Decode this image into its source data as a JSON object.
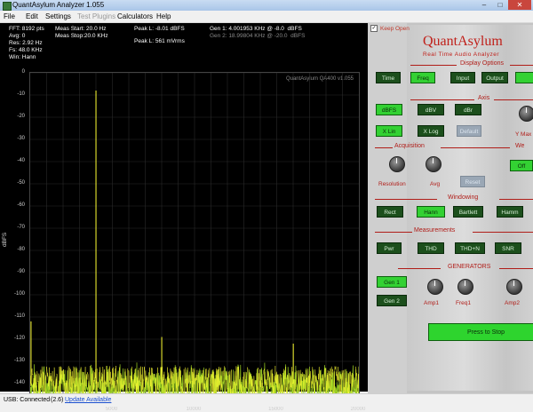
{
  "window": {
    "title": "QuantAsylum Analyzer 1.055",
    "min": "–",
    "max": "□",
    "close": "✕"
  },
  "menu": [
    {
      "label": "File",
      "enabled": true
    },
    {
      "label": "Edit",
      "enabled": true
    },
    {
      "label": "Settings",
      "enabled": true
    },
    {
      "label": "Test Plugins",
      "enabled": false
    },
    {
      "label": "Calculators",
      "enabled": true
    },
    {
      "label": "Help",
      "enabled": true
    }
  ],
  "readout": {
    "fft": "FFT: 8192 pts",
    "avg": "Avg: 0",
    "res": "Res: 2.92 Hz",
    "fs": "Fs: 48.0 KHz",
    "win": "Win: Hann",
    "meas_start": "Meas Start: 20.0 Hz",
    "meas_stop": "Meas Stop:20.0 KHz",
    "peak_l": "Peak L: -8.01 dBFS",
    "peak_l2": "Peak L: 561 mVrms",
    "gen1": "Gen 1: 4.001953 KHz @ -8.0  dBFS",
    "gen2": "Gen 2: 18.99804 KHz @ -20.0  dBFS",
    "watermark": "QuantAsylum QA400 v1.055"
  },
  "chart_data": {
    "type": "line",
    "xlabel": "",
    "ylabel": "dBFS",
    "xlim": [
      0,
      20000
    ],
    "ylim": [
      -150,
      0
    ],
    "x_ticks": [
      "5000",
      "10000",
      "15000",
      "20000"
    ],
    "y_ticks": [
      "0",
      "-10",
      "-20",
      "-30",
      "-40",
      "-50",
      "-60",
      "-70",
      "-80",
      "-90",
      "-100",
      "-110",
      "-120",
      "-130",
      "-140",
      "-150"
    ],
    "noise_floor": [
      -148,
      -130
    ],
    "peaks": [
      {
        "x": 4002,
        "y": -8
      },
      {
        "x": 8004,
        "y": -119
      },
      {
        "x": 16008,
        "y": -122
      },
      {
        "x": 50,
        "y": -112
      }
    ],
    "colors": {
      "trace": "#ffff33",
      "floor": "#99cc22"
    }
  },
  "status": {
    "connection": "USB: Connected",
    "count": "(2.6)",
    "update": "Update Available"
  },
  "panel": {
    "keep_open": "Keep Open",
    "logo": "QuantAsylum",
    "sublogo": "Real Time Audio Analyzer",
    "display_options": "Display Options",
    "display_buttons": [
      "Time",
      "Freq",
      "Input",
      "Output"
    ],
    "axis": "Axis",
    "axis_buttons": [
      "dBFS",
      "dBV",
      "dBr"
    ],
    "xlin": "X Lin",
    "xlog": "X Log",
    "default_btn": "Default",
    "y_max": "Y Max",
    "acquisition": "Acquisition",
    "resolution": "Resolution",
    "avg": "Avg",
    "reset": "Reset",
    "we": "We",
    "off": "Off",
    "windowing": "Windowing",
    "window_buttons": [
      "Rect",
      "Hann",
      "Bartlett",
      "Hamm"
    ],
    "measurements": "Measurements",
    "meas_buttons": [
      "Pwr",
      "THD",
      "THD+N",
      "SNR"
    ],
    "generators": "GENERATORS",
    "gen1": "Gen 1",
    "gen2": "Gen 2",
    "amp1": "Amp1",
    "freq1": "Freq1",
    "amp2": "Amp2",
    "stop": "Press to Stop"
  }
}
